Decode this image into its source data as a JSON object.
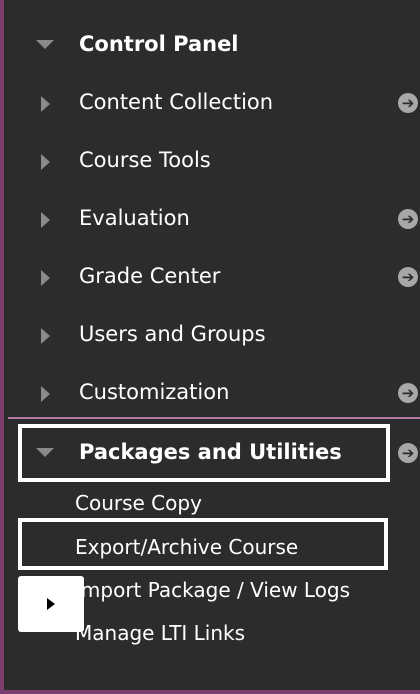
{
  "menu": {
    "header": {
      "label": "Control Panel",
      "expanded": true
    },
    "items": [
      {
        "label": "Content Collection",
        "has_go": true
      },
      {
        "label": "Course Tools",
        "has_go": false
      },
      {
        "label": "Evaluation",
        "has_go": true
      },
      {
        "label": "Grade Center",
        "has_go": true
      },
      {
        "label": "Users and Groups",
        "has_go": false
      },
      {
        "label": "Customization",
        "has_go": true
      }
    ],
    "active_section": {
      "label": "Packages and Utilities",
      "expanded": true,
      "has_go": true,
      "subitems": [
        {
          "label": "Course Copy"
        },
        {
          "label": "Export/Archive Course"
        },
        {
          "label": "Import Package / View Logs"
        },
        {
          "label": "Manage LTI Links"
        }
      ]
    }
  },
  "icons": {
    "collapsed": "triangle-right-icon",
    "expanded": "triangle-down-icon",
    "go": "arrow-circle-icon",
    "play": "play-icon",
    "go_glyph": "➔"
  },
  "colors": {
    "panel_bg": "#2c2c2c",
    "frame_border": "#7b3f6e",
    "divider": "#b07aa4",
    "highlight_border": "#ffffff",
    "text": "#ffffff",
    "triangle": "#8a8a8a",
    "go_icon_bg": "#a8a8a8"
  }
}
